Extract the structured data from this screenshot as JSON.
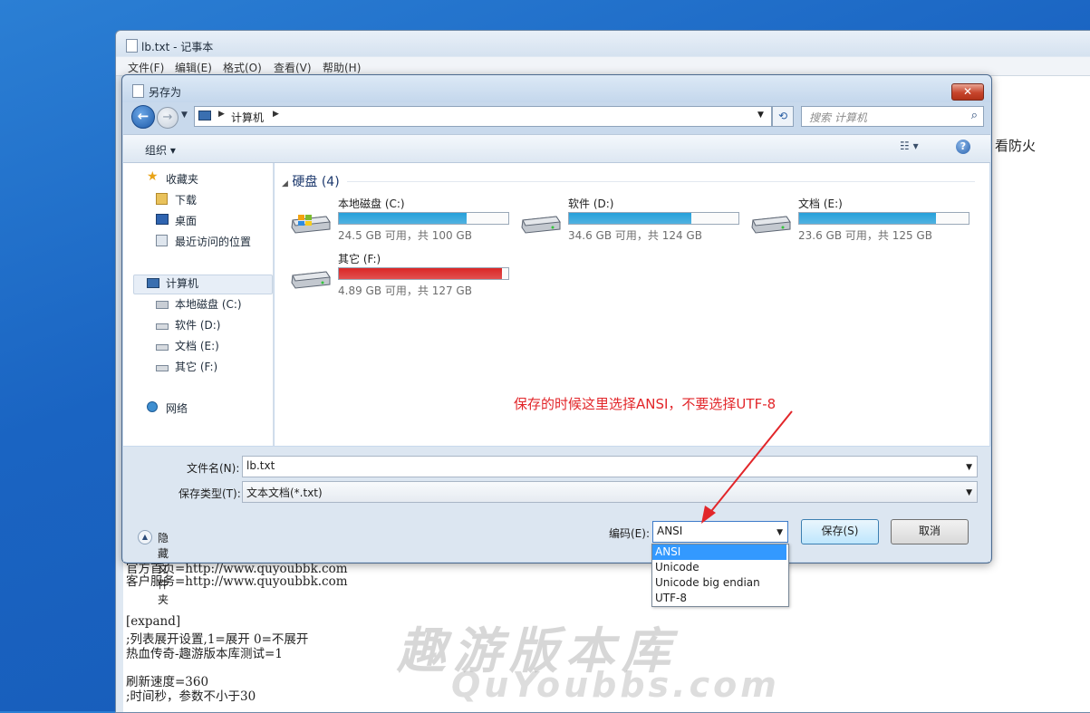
{
  "notepad": {
    "title": "lb.txt - 记事本",
    "menu": [
      "文件(F)",
      "编辑(E)",
      "格式(O)",
      "查看(V)",
      "帮助(H)"
    ],
    "partial_text": "看防火",
    "lines": [
      "官方首页=http://www.quyoubbk.com",
      "客户服务=http://www.quyoubbk.com",
      "[expand]",
      ";列表展开设置,1=展开 0=不展开",
      "热血传奇-趣游版本库测试=1",
      "刷新速度=360",
      ";时间秒，参数不小于30"
    ],
    "watermark": {
      "cn": "趣游版本库",
      "en": "QuYoubbs.com"
    }
  },
  "dialog": {
    "title": "另存为",
    "close_label": "✕",
    "address": {
      "location": "计算机"
    },
    "search_placeholder": "搜索 计算机",
    "organize_label": "组织 ▾",
    "nav": {
      "favorites": "收藏夹",
      "downloads": "下载",
      "desktop": "桌面",
      "recent": "最近访问的位置",
      "computer": "计算机",
      "drive_c": "本地磁盘 (C:)",
      "drive_d": "软件 (D:)",
      "drive_e": "文档 (E:)",
      "drive_f": "其它 (F:)",
      "network": "网络"
    },
    "group_header": "硬盘 (4)",
    "drives": [
      {
        "name": "本地磁盘 (C:)",
        "space": "24.5 GB 可用，共 100 GB",
        "used_fraction": 0.755,
        "bar_color": "#26a0da"
      },
      {
        "name": "软件 (D:)",
        "space": "34.6 GB 可用，共 124 GB",
        "used_fraction": 0.72,
        "bar_color": "#26a0da"
      },
      {
        "name": "文档 (E:)",
        "space": "23.6 GB 可用，共 125 GB",
        "used_fraction": 0.81,
        "bar_color": "#26a0da"
      },
      {
        "name": "其它 (F:)",
        "space": "4.89 GB 可用，共 127 GB",
        "used_fraction": 0.962,
        "bar_color": "#da2626"
      }
    ],
    "filename_label": "文件名(N):",
    "filename_value": "lb.txt",
    "filetype_label": "保存类型(T):",
    "filetype_value": "文本文档(*.txt)",
    "hide_folders_label": "隐藏文件夹",
    "encoding_label": "编码(E):",
    "encoding_value": "ANSI",
    "save_label": "保存(S)",
    "cancel_label": "取消"
  },
  "encoding_options": [
    "ANSI",
    "Unicode",
    "Unicode big endian",
    "UTF-8"
  ],
  "annotation": "保存的时候这里选择ANSI，不要选择UTF-8"
}
